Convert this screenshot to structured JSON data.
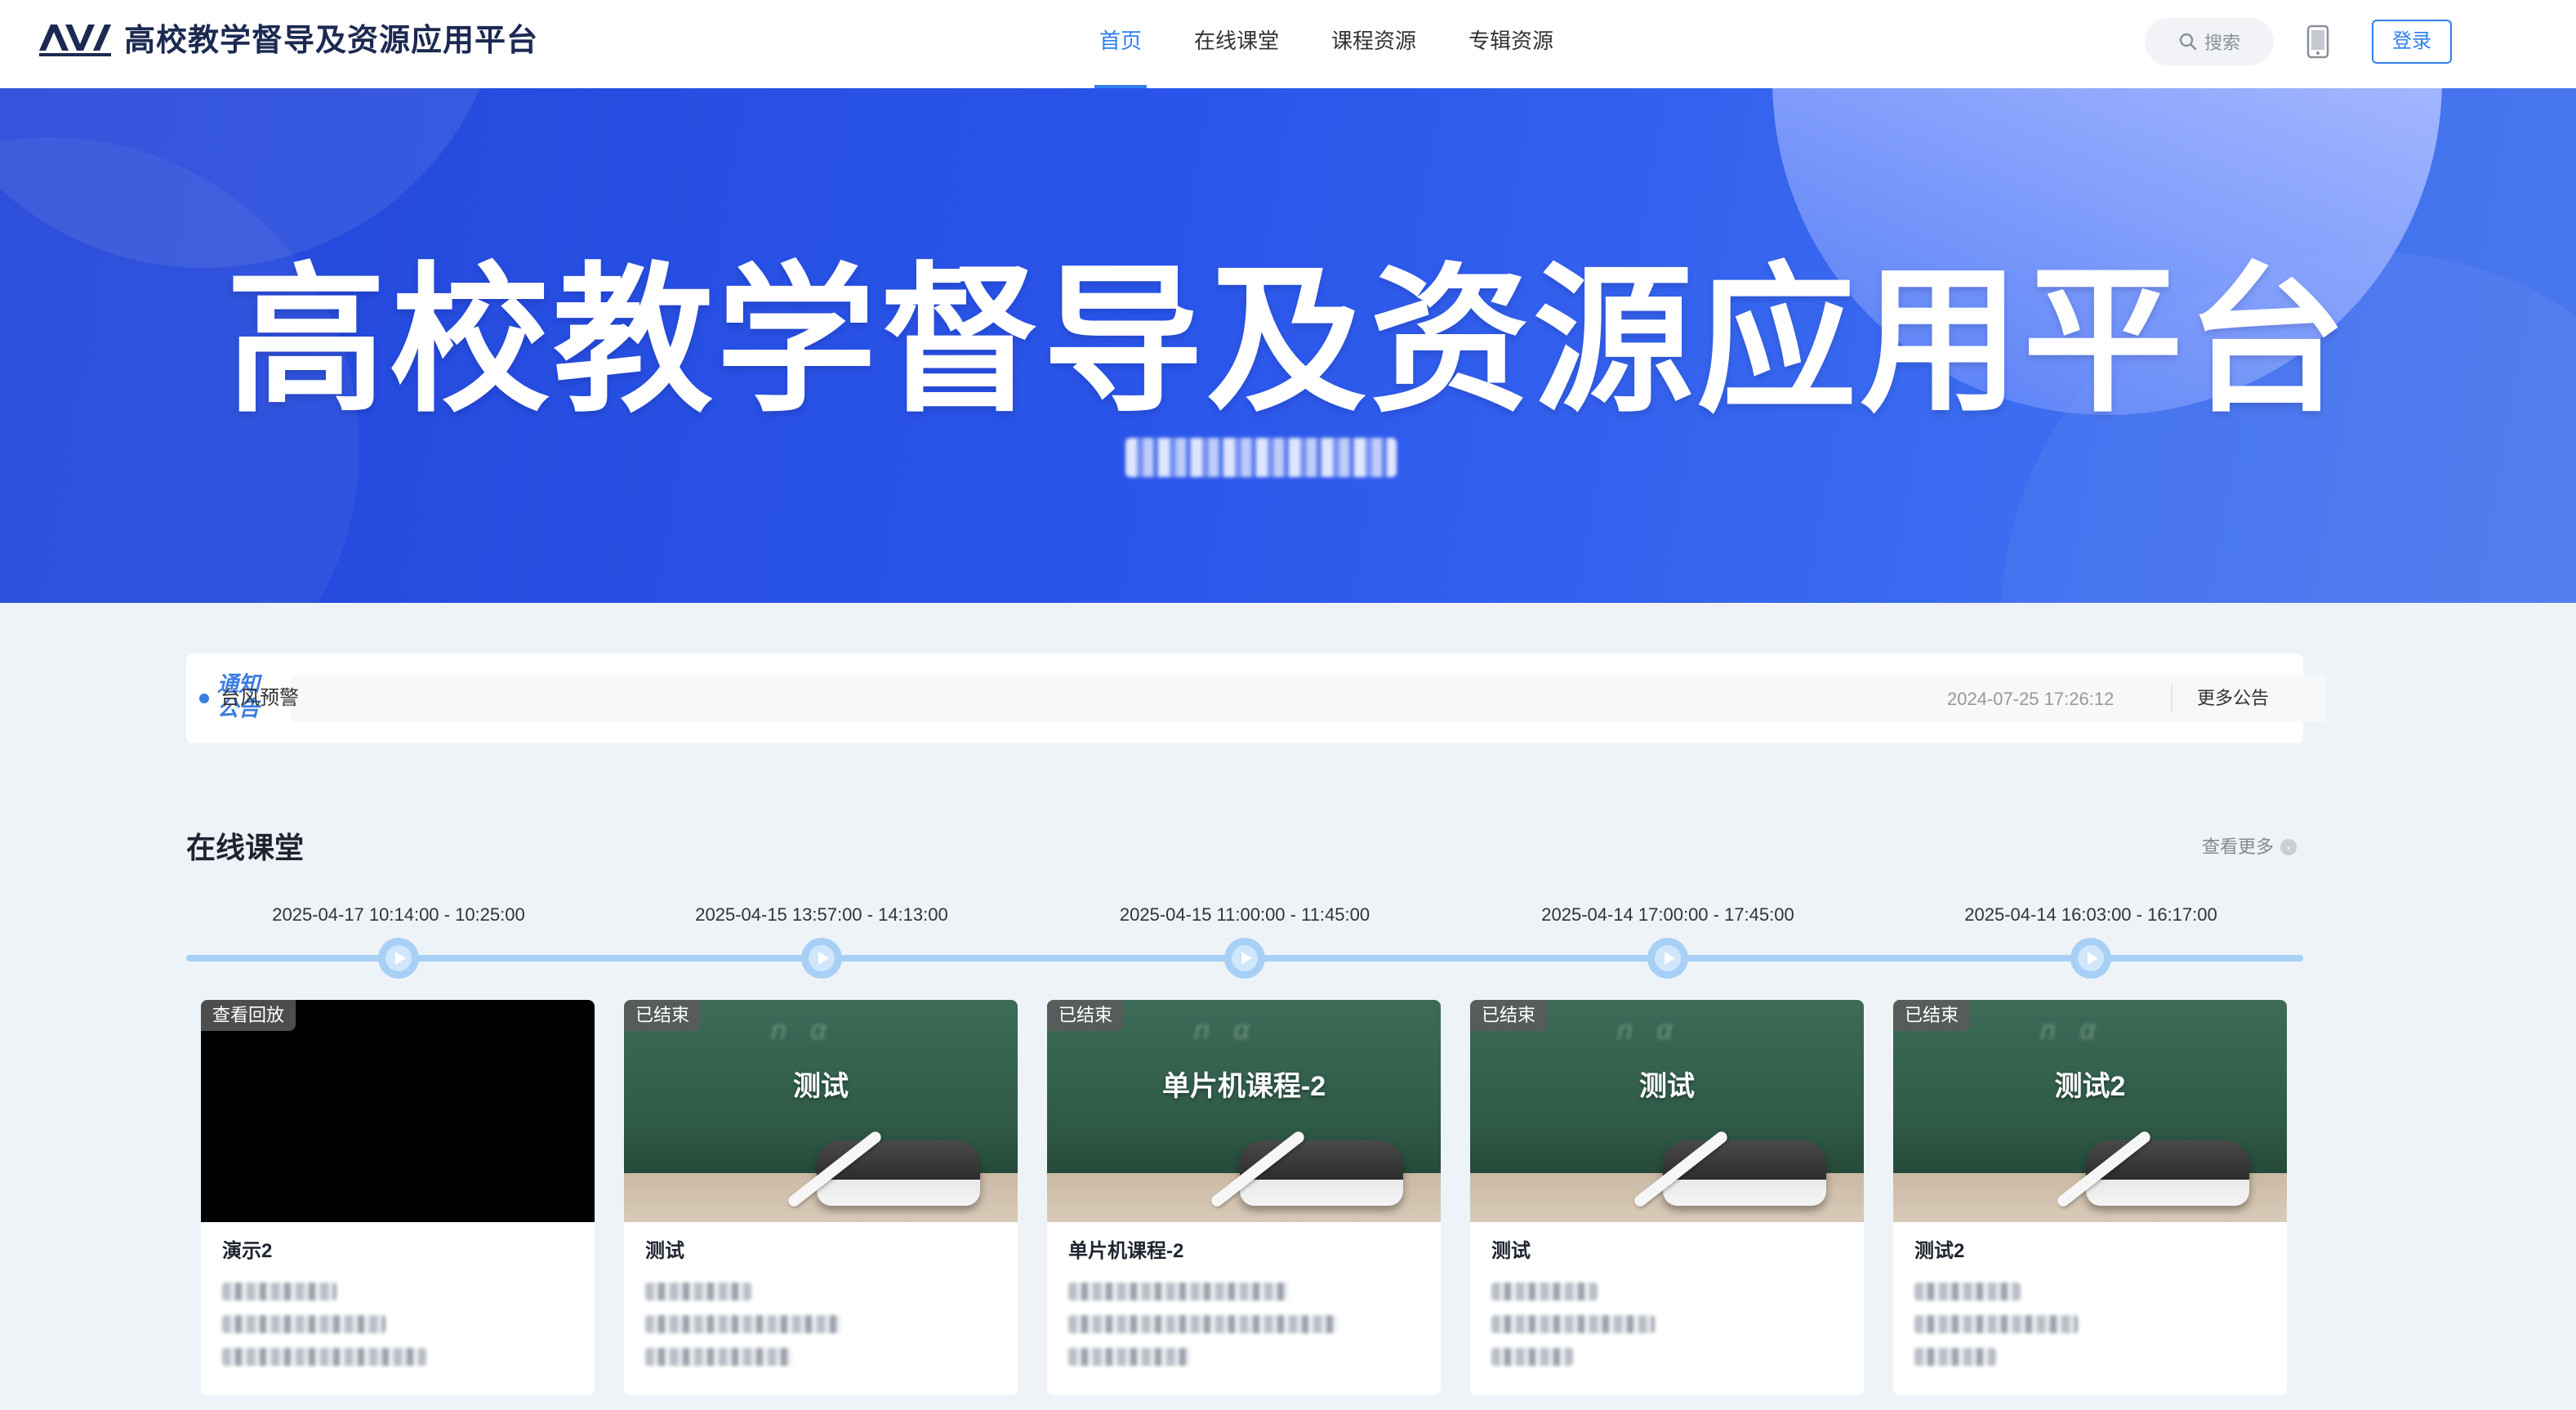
{
  "header": {
    "site_title": "高校教学督导及资源应用平台",
    "nav": [
      "首页",
      "在线课堂",
      "课程资源",
      "专辑资源"
    ],
    "active_nav": 0,
    "search_label": "搜索",
    "login_label": "登录"
  },
  "banner": {
    "title": "高校教学督导及资源应用平台"
  },
  "notice": {
    "badge_line1": "通知",
    "badge_line2": "公告",
    "text": "台风预警",
    "date": "2024-07-25 17:26:12",
    "more": "更多公告"
  },
  "online": {
    "title": "在线课堂",
    "view_more": "查看更多",
    "timeline": [
      "2025-04-17 10:14:00 - 10:25:00",
      "2025-04-15 13:57:00 - 14:13:00",
      "2025-04-15 11:00:00 - 11:45:00",
      "2025-04-14 17:00:00 - 17:45:00",
      "2025-04-14 16:03:00 - 16:17:00"
    ],
    "cards": [
      {
        "status": "查看回放",
        "thumb_title": "",
        "name": "演示2",
        "thumb": "black"
      },
      {
        "status": "已结束",
        "thumb_title": "测试",
        "name": "测试",
        "thumb": "board"
      },
      {
        "status": "已结束",
        "thumb_title": "单片机课程-2",
        "name": "单片机课程-2",
        "thumb": "board"
      },
      {
        "status": "已结束",
        "thumb_title": "测试",
        "name": "测试",
        "thumb": "board"
      },
      {
        "status": "已结束",
        "thumb_title": "测试2",
        "name": "测试2",
        "thumb": "board"
      }
    ]
  },
  "colors": {
    "accent": "#2f80ed",
    "banner": "#2a55ea",
    "timeline": "#a8d0f6"
  }
}
